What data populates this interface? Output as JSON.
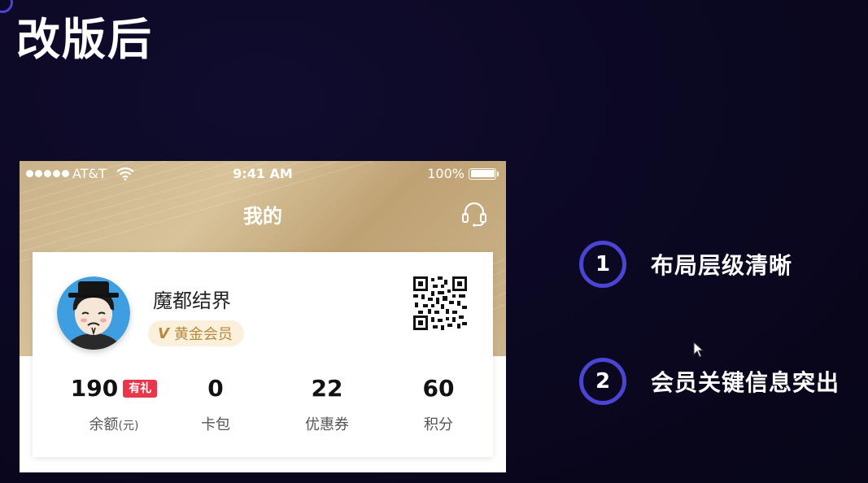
{
  "slide": {
    "title": "改版后"
  },
  "phone": {
    "status_bar": {
      "carrier": "AT&T",
      "time": "9:41 AM",
      "battery": "100%"
    },
    "nav": {
      "title": "我的",
      "right_icon": "headset-icon"
    },
    "profile": {
      "username": "魔都结界",
      "member_mark": "V",
      "member_level": "黄金会员",
      "qr_icon": "qr-code-icon"
    },
    "stats": [
      {
        "value": "190",
        "tag": "有礼",
        "label": "余额",
        "label_suffix": "(元)"
      },
      {
        "value": "0",
        "label": "卡包"
      },
      {
        "value": "22",
        "label": "优惠券"
      },
      {
        "value": "60",
        "label": "积分"
      }
    ]
  },
  "points": [
    {
      "number": "1",
      "text": "布局层级清晰"
    },
    {
      "number": "2",
      "text": "会员关键信息突出"
    }
  ],
  "colors": {
    "background": "#0a0720",
    "accent": "#4b44d4",
    "gold": "#c9b289",
    "badge_text": "#b8893a",
    "gift_tag": "#e8364a"
  }
}
